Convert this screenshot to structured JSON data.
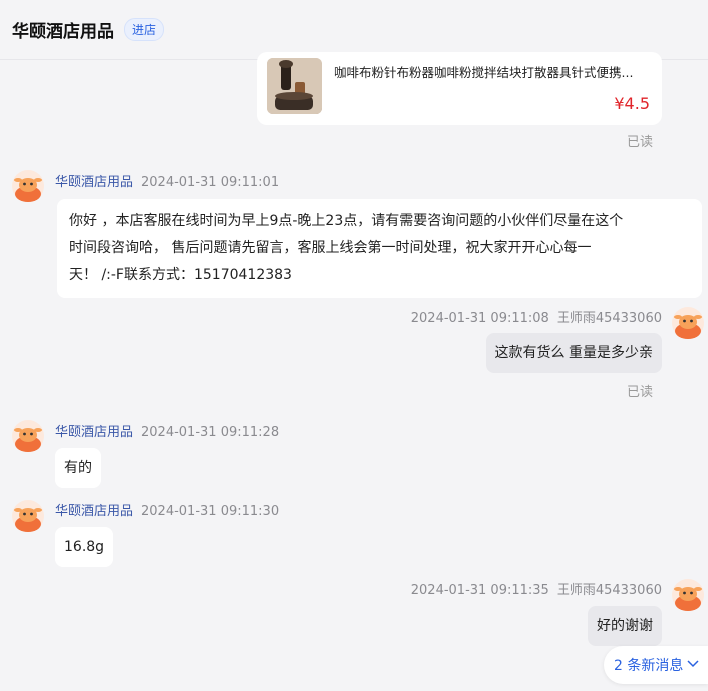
{
  "header": {
    "shop_name": "华颐酒店用品",
    "enter_label": "进店"
  },
  "product": {
    "title": "咖啡布粉针布粉器咖啡粉搅拌结块打散器具针式便携...",
    "price": "¥4.5"
  },
  "read_label": "已读",
  "messages": [
    {
      "sender": "华颐酒店用品",
      "time": "2024-01-31 09:11:01",
      "lines": [
        "你好 ，本店客服在线时间为早上9点-晚上23点，请有需要咨询问题的小伙伴们尽量在这个",
        "时间段咨询哈， 售后问题请先留言，客服上线会第一时间处理，祝大家开开心心每一",
        "天！ /:-F联系方式：15170412383"
      ]
    },
    {
      "sender": "王师雨45433060",
      "time": "2024-01-31 09:11:08",
      "text": "这款有货么  重量是多少亲"
    },
    {
      "sender": "华颐酒店用品",
      "time": "2024-01-31 09:11:28",
      "text": "有的"
    },
    {
      "sender": "华颐酒店用品",
      "time": "2024-01-31 09:11:30",
      "text": "16.8g"
    },
    {
      "sender": "王师雨45433060",
      "time": "2024-01-31 09:11:35",
      "text": "好的谢谢"
    }
  ],
  "new_messages": {
    "label": "2 条新消息",
    "icon": "chevron-down-icon"
  },
  "colors": {
    "link_blue": "#2a62e0",
    "price_red": "#e0242a",
    "sender_blue": "#3a57a8"
  }
}
